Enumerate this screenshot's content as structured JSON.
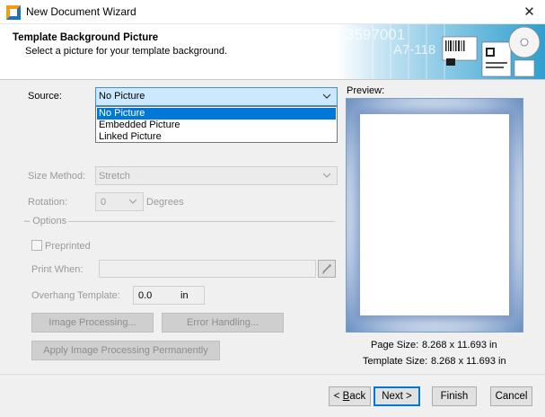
{
  "window": {
    "title": "New Document Wizard",
    "close_glyph": "✕"
  },
  "header": {
    "title": "Template Background Picture",
    "subtitle": "Select a picture for your template background.",
    "banner_text_1": "3597001",
    "banner_text_2": "A7-118"
  },
  "source": {
    "label": "Source:",
    "value": "No Picture",
    "options": [
      "No Picture",
      "Embedded Picture",
      "Linked Picture"
    ],
    "selected_index": 0
  },
  "size_method": {
    "label": "Size Method:",
    "value": "Stretch"
  },
  "rotation": {
    "label": "Rotation:",
    "value": "0",
    "unit": "Degrees"
  },
  "options_group": {
    "label": "Options"
  },
  "preprinted": {
    "label": "Preprinted",
    "checked": false
  },
  "print_when": {
    "label": "Print When:",
    "value": ""
  },
  "overhang": {
    "label": "Overhang Template:",
    "value": "0.0",
    "unit": "in"
  },
  "buttons": {
    "image_processing": "Image Processing...",
    "error_handling": "Error Handling...",
    "apply_image_processing": "Apply Image Processing Permanently",
    "back_prefix": "< ",
    "back_key": "B",
    "back_rest": "ack",
    "next": "Next >",
    "finish": "Finish",
    "cancel": "Cancel"
  },
  "preview": {
    "label": "Preview:",
    "page_size_label": "Page Size:",
    "page_size_value": "8.268 x 11.693 in",
    "template_size_label": "Template Size:",
    "template_size_value": "8.268 x 11.693 in"
  },
  "colors": {
    "selection": "#0078d7",
    "select_focus_bg": "#cce8ff",
    "preview_bg": "#5a83b8"
  },
  "icons": {
    "app": "wizard-app-icon",
    "chevron": "chevron-down-icon",
    "expression": "expression-pen-icon"
  }
}
